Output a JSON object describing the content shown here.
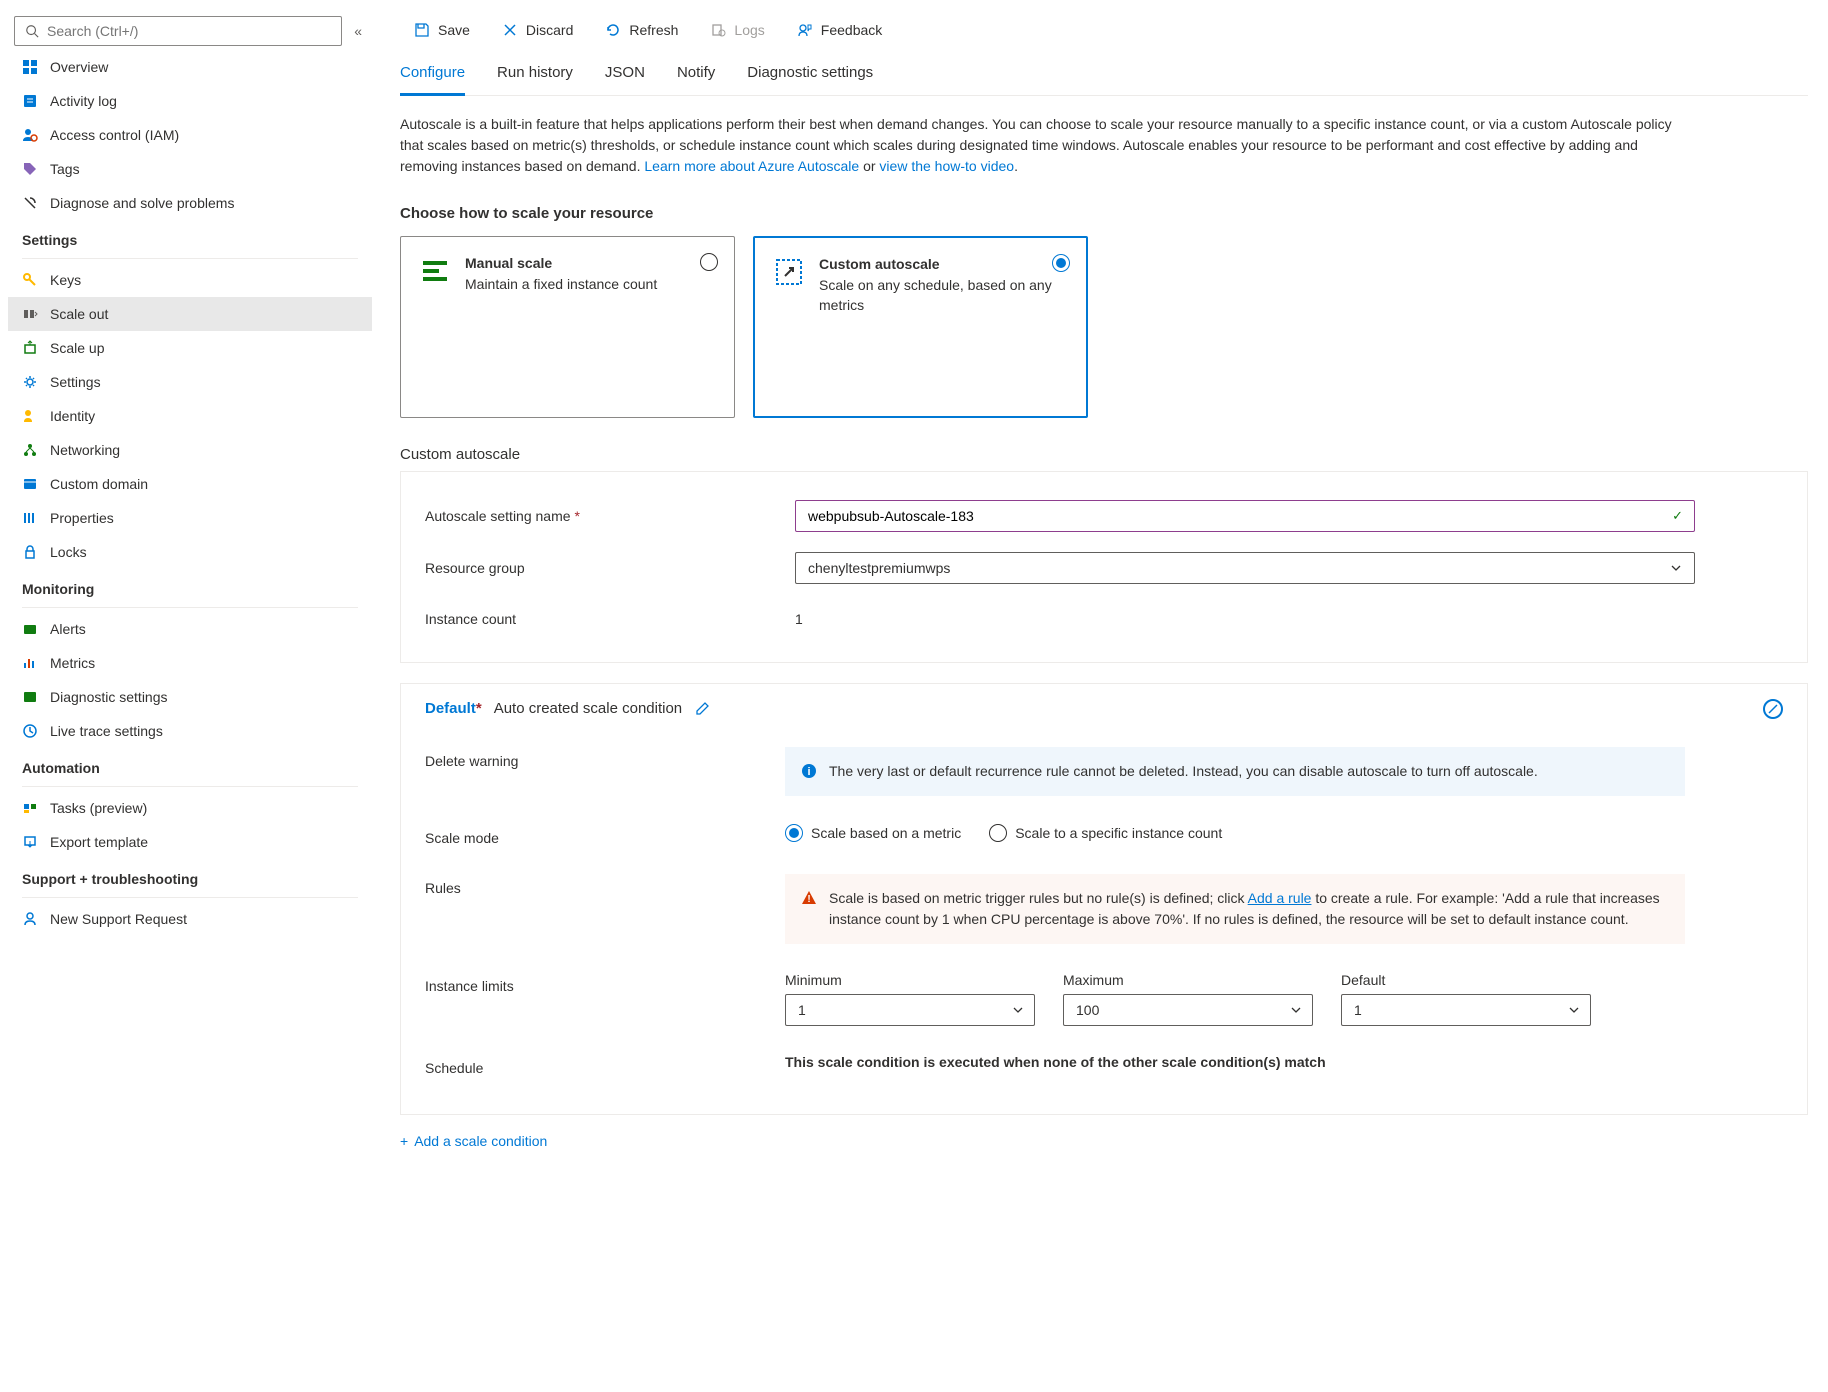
{
  "search": {
    "placeholder": "Search (Ctrl+/)"
  },
  "nav": {
    "overview": "Overview",
    "activityLog": "Activity log",
    "accessControl": "Access control (IAM)",
    "tags": "Tags",
    "diagnose": "Diagnose and solve problems",
    "settings_title": "Settings",
    "keys": "Keys",
    "scaleOut": "Scale out",
    "scaleUp": "Scale up",
    "settings": "Settings",
    "identity": "Identity",
    "networking": "Networking",
    "customDomain": "Custom domain",
    "properties": "Properties",
    "locks": "Locks",
    "monitoring_title": "Monitoring",
    "alerts": "Alerts",
    "metrics": "Metrics",
    "diagSettings": "Diagnostic settings",
    "liveTrace": "Live trace settings",
    "automation_title": "Automation",
    "tasks": "Tasks (preview)",
    "export": "Export template",
    "support_title": "Support + troubleshooting",
    "newSupport": "New Support Request"
  },
  "toolbar": {
    "save": "Save",
    "discard": "Discard",
    "refresh": "Refresh",
    "logs": "Logs",
    "feedback": "Feedback"
  },
  "tabs": {
    "configure": "Configure",
    "runHistory": "Run history",
    "json": "JSON",
    "notify": "Notify",
    "diagnostic": "Diagnostic settings"
  },
  "description": {
    "text1": "Autoscale is a built-in feature that helps applications perform their best when demand changes. You can choose to scale your resource manually to a specific instance count, or via a custom Autoscale policy that scales based on metric(s) thresholds, or schedule instance count which scales during designated time windows. Autoscale enables your resource to be performant and cost effective by adding and removing instances based on demand. ",
    "link1": "Learn more about Azure Autoscale",
    "or": " or ",
    "link2": "view the how-to video",
    "period": "."
  },
  "chooseHeading": "Choose how to scale your resource",
  "scaleCards": {
    "manual": {
      "title": "Manual scale",
      "desc": "Maintain a fixed instance count"
    },
    "custom": {
      "title": "Custom autoscale",
      "desc": "Scale on any schedule, based on any metrics"
    }
  },
  "form": {
    "title": "Custom autoscale",
    "settingNameLabel": "Autoscale setting name",
    "settingNameValue": "webpubsub-Autoscale-183",
    "resourceGroupLabel": "Resource group",
    "resourceGroupValue": "chenyltestpremiumwps",
    "instanceCountLabel": "Instance count",
    "instanceCountValue": "1"
  },
  "condition": {
    "title": "Default",
    "subtitle": "Auto created scale condition",
    "deleteWarningLabel": "Delete warning",
    "deleteWarningText": "The very last or default recurrence rule cannot be deleted. Instead, you can disable autoscale to turn off autoscale.",
    "scaleModeLabel": "Scale mode",
    "scaleModeMetric": "Scale based on a metric",
    "scaleModeInstance": "Scale to a specific instance count",
    "rulesLabel": "Rules",
    "rulesText1": "Scale is based on metric trigger rules but no rule(s) is defined; click ",
    "rulesLink": "Add a rule",
    "rulesText2": " to create a rule. For example: 'Add a rule that increases instance count by 1 when CPU percentage is above 70%'. If no rules is defined, the resource will be set to default instance count.",
    "instanceLimitsLabel": "Instance limits",
    "minLabel": "Minimum",
    "minValue": "1",
    "maxLabel": "Maximum",
    "maxValue": "100",
    "defLabel": "Default",
    "defValue": "1",
    "scheduleLabel": "Schedule",
    "scheduleText": "This scale condition is executed when none of the other scale condition(s) match"
  },
  "addCondition": "Add a scale condition"
}
